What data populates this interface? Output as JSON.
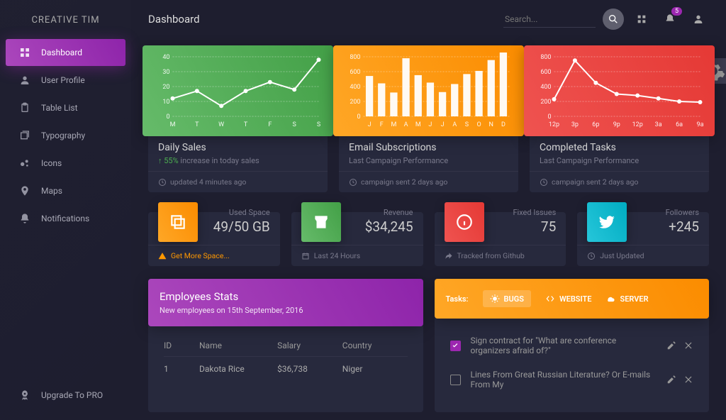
{
  "brand": "CREATIVE TIM",
  "page_title": "Dashboard",
  "search": {
    "placeholder": "Search..."
  },
  "notification_badge": "5",
  "sidebar": {
    "items": [
      {
        "label": "Dashboard"
      },
      {
        "label": "User Profile"
      },
      {
        "label": "Table List"
      },
      {
        "label": "Typography"
      },
      {
        "label": "Icons"
      },
      {
        "label": "Maps"
      },
      {
        "label": "Notifications"
      }
    ],
    "upgrade": "Upgrade To PRO"
  },
  "chart_data": [
    {
      "type": "line",
      "title": "Daily Sales",
      "sub_prefix": "↑ 55% ",
      "sub": "increase in today sales",
      "footer": "updated 4 minutes ago",
      "categories": [
        "M",
        "T",
        "W",
        "T",
        "F",
        "S",
        "S"
      ],
      "y_ticks": [
        0,
        10,
        20,
        30,
        40
      ],
      "ylim": [
        0,
        40
      ],
      "values": [
        12,
        17,
        7,
        17,
        23,
        18,
        38
      ]
    },
    {
      "type": "bar",
      "title": "Email Subscriptions",
      "sub": "Last Campaign Performance",
      "footer": "campaign sent 2 days ago",
      "categories": [
        "J",
        "F",
        "M",
        "A",
        "M",
        "J",
        "J",
        "A",
        "S",
        "O",
        "N",
        "D"
      ],
      "y_ticks": [
        0,
        200,
        400,
        600,
        800
      ],
      "ylim": [
        0,
        800
      ],
      "values": [
        542,
        443,
        320,
        780,
        553,
        453,
        326,
        434,
        568,
        610,
        756,
        895
      ]
    },
    {
      "type": "line",
      "title": "Completed Tasks",
      "sub": "Last Campaign Performance",
      "footer": "campaign sent 2 days ago",
      "categories": [
        "12p",
        "3p",
        "6p",
        "9p",
        "12p",
        "3a",
        "6a",
        "9a"
      ],
      "y_ticks": [
        0,
        200,
        400,
        600,
        800
      ],
      "ylim": [
        0,
        800
      ],
      "values": [
        230,
        750,
        450,
        300,
        280,
        240,
        200,
        190
      ]
    }
  ],
  "stats": [
    {
      "label": "Used Space",
      "value": "49/50 GB",
      "footer": "Get More Space...",
      "warn": true
    },
    {
      "label": "Revenue",
      "value": "$34,245",
      "footer": "Last 24 Hours"
    },
    {
      "label": "Fixed Issues",
      "value": "75",
      "footer": "Tracked from Github"
    },
    {
      "label": "Followers",
      "value": "+245",
      "footer": "Just Updated"
    }
  ],
  "employees": {
    "title": "Employees Stats",
    "subtitle": "New employees on 15th September, 2016",
    "columns": {
      "id": "ID",
      "name": "Name",
      "salary": "Salary",
      "country": "Country"
    },
    "rows": [
      {
        "id": "1",
        "name": "Dakota Rice",
        "salary": "$36,738",
        "country": "Niger"
      }
    ]
  },
  "tasks": {
    "label": "Tasks:",
    "tabs": [
      "BUGS",
      "WEBSITE",
      "SERVER"
    ],
    "items": [
      {
        "done": true,
        "text": "Sign contract for \"What are conference organizers afraid of?\""
      },
      {
        "done": false,
        "text": "Lines From Great Russian Literature? Or E-mails From My"
      }
    ]
  }
}
